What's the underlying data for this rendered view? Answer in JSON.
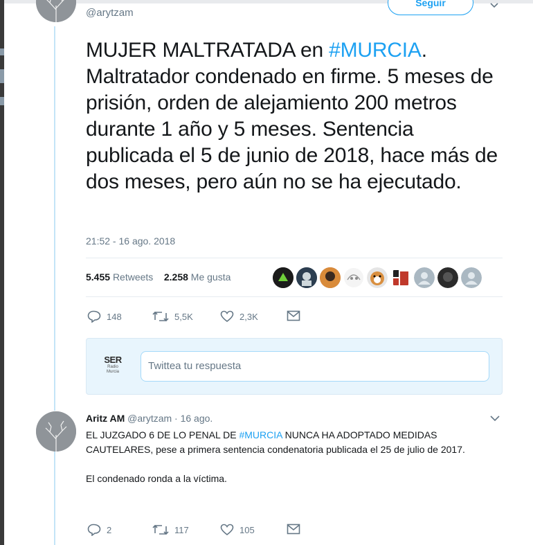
{
  "tweet": {
    "handle": "@arytzam",
    "follow_label": "Seguir",
    "text_pre": "MUJER MALTRATADA en ",
    "hashtag": "#MURCIA",
    "text_post": ". Maltratador condenado en firme. 5 meses de prisión, orden de alejamiento 200 metros durante 1 año y 5 meses. Sentencia publicada el 5 de junio de 2018, hace más de dos meses, pero aún no se ha ejecutado.",
    "timestamp": "21:52 - 16 ago. 2018",
    "retweets_count": "5.455",
    "retweets_label": "Retweets",
    "likes_count": "2.258",
    "likes_label": "Me gusta",
    "actions": {
      "replies": "148",
      "retweets": "5,5K",
      "likes": "2,3K"
    }
  },
  "reply_box": {
    "logo_text": "SER",
    "logo_sub1": "Radio",
    "logo_sub2": "Murcia",
    "placeholder": "Twittea tu respuesta"
  },
  "reply": {
    "name": "Aritz AM",
    "handle": "@arytzam",
    "date": "· 16 ago.",
    "line1_pre": "EL JUZGADO 6 DE LO PENAL DE ",
    "hashtag": "#MURCIA",
    "line1_post": " NUNCA HA ADOPTADO MEDIDAS CAUTELARES, pese a primera sentencia condenatoria publicada el 25 de julio de 2017.",
    "line2": "El condenado ronda a la víctima.",
    "actions": {
      "replies": "2",
      "retweets": "117",
      "likes": "105"
    }
  },
  "colors": {
    "accent": "#1da1f2",
    "muted": "#657786",
    "text": "#14171a"
  }
}
